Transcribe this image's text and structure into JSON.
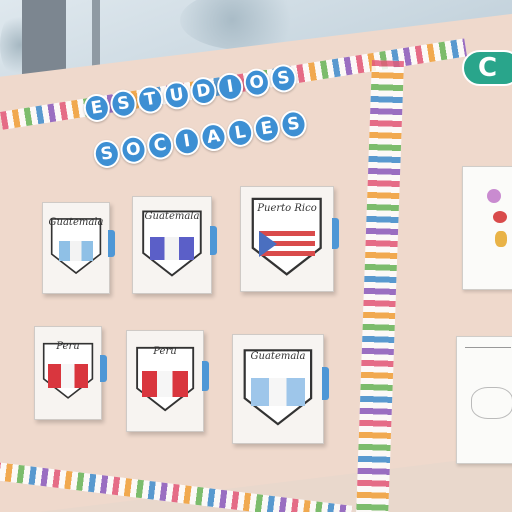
{
  "board_title": {
    "line1": [
      "E",
      "S",
      "T",
      "U",
      "D",
      "I",
      "O",
      "S"
    ],
    "line2": [
      "S",
      "O",
      "C",
      "I",
      "A",
      "L",
      "E",
      "S"
    ]
  },
  "right_sign_letter": "C",
  "cards": [
    {
      "label": "Guatemala",
      "flag": "guatemala"
    },
    {
      "label": "Guatemala",
      "flag": "guatemala"
    },
    {
      "label": "Puerto Rico",
      "flag": "puerto-rico"
    },
    {
      "label": "Peru",
      "flag": "peru"
    },
    {
      "label": "Peru",
      "flag": "peru"
    },
    {
      "label": "Guatemala",
      "flag": "guatemala"
    }
  ],
  "colors": {
    "title_letters": "#3d8fd3",
    "right_sign": "#29a58b",
    "board": "#efd9cc",
    "card_tab": "#4e97d6"
  }
}
